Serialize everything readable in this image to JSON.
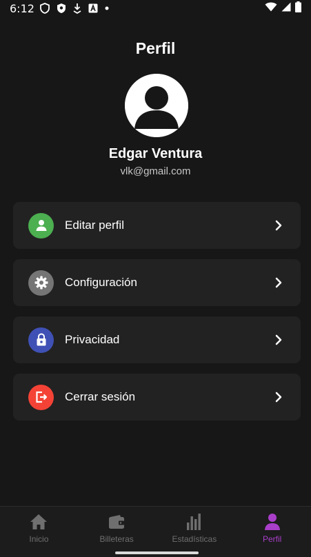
{
  "status_bar": {
    "time": "6:12",
    "left_icons": [
      "shield-icon",
      "shield-filled-icon",
      "download-icon",
      "a-box-icon",
      "dot-icon"
    ],
    "right_icons": [
      "wifi-icon",
      "signal-icon",
      "battery-icon"
    ]
  },
  "header": {
    "title": "Perfil"
  },
  "profile": {
    "name": "Edgar Ventura",
    "email": "vlk@gmail.com",
    "avatar_icon": "user-avatar-icon"
  },
  "menu": {
    "items": [
      {
        "label": "Editar perfil",
        "icon": "user-icon",
        "color": "#4caf50"
      },
      {
        "label": "Configuración",
        "icon": "gear-icon",
        "color": "#757575"
      },
      {
        "label": "Privacidad",
        "icon": "lock-icon",
        "color": "#3f51b5"
      },
      {
        "label": "Cerrar sesión",
        "icon": "logout-icon",
        "color": "#f44336"
      }
    ]
  },
  "bottom_nav": {
    "items": [
      {
        "label": "Inicio",
        "icon": "home-icon",
        "active": false
      },
      {
        "label": "Billeteras",
        "icon": "wallet-icon",
        "active": false
      },
      {
        "label": "Estadísticas",
        "icon": "bar-chart-icon",
        "active": false
      },
      {
        "label": "Perfil",
        "icon": "person-icon",
        "active": true
      }
    ],
    "active_color": "#a93ec9",
    "inactive_color": "#6f6f6f"
  }
}
